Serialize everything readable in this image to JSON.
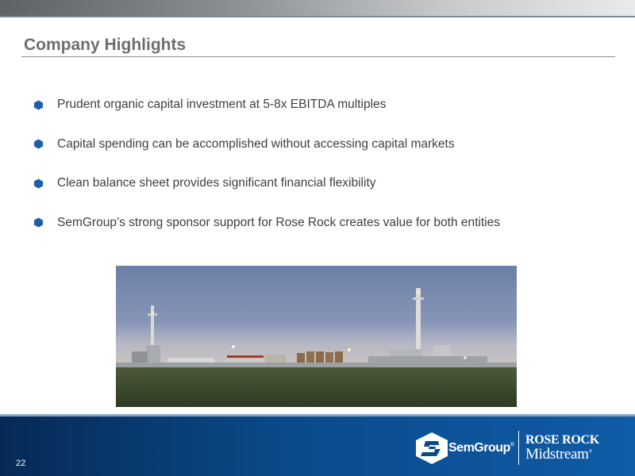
{
  "slide": {
    "title": "Company Highlights",
    "page_number": "22"
  },
  "bullets": [
    "Prudent organic capital investment at 5-8x EBITDA multiples",
    "Capital spending can be accomplished without accessing capital markets",
    "Clean balance sheet provides significant financial flexibility",
    "SemGroup’s strong sponsor support for Rose Rock creates value for both entities"
  ],
  "footer": {
    "semgroup_logo_text": "SemGroup",
    "semgroup_registered": "®",
    "rose_rock_line1": "ROSE ROCK",
    "rose_rock_line2": "Midstream",
    "rose_rock_registered": "®"
  },
  "colors": {
    "bullet": "#1f5ea8",
    "footer_blue": "#0a4a8a",
    "title_gray": "#6b6e70"
  },
  "icons": {
    "bullet_marker": "hexagon-bullet-icon",
    "semgroup_mark": "semgroup-logo-icon"
  }
}
